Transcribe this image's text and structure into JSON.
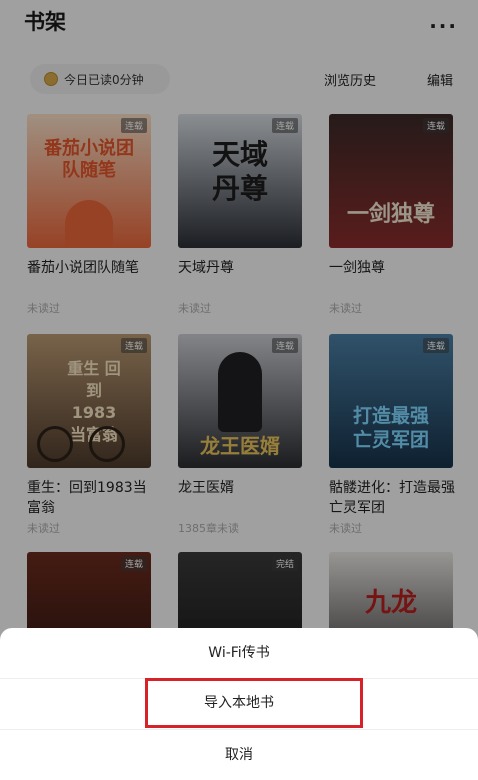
{
  "header": {
    "title": "书架",
    "more_label": "···"
  },
  "toolbar": {
    "reading_time": "今日已读0分钟",
    "history": "浏览历史",
    "edit": "编辑"
  },
  "books": [
    {
      "title": "番茄小说团队随笔",
      "status": "未读过",
      "tag": "连载",
      "cover_text": "番茄小说团队随笔",
      "colors": [
        "#f6ddc6",
        "#e8663a"
      ]
    },
    {
      "title": "天域丹尊",
      "status": "未读过",
      "tag": "连载",
      "cover_text": "天域丹尊",
      "colors": [
        "#d6dbe0",
        "#2a2e36"
      ]
    },
    {
      "title": "一剑独尊",
      "status": "未读过",
      "tag": "连载",
      "cover_text": "一剑独尊",
      "colors": [
        "#3a2a28",
        "#8a2b2b"
      ]
    },
    {
      "title": "重生：回到1983当富翁",
      "status": "未读过",
      "tag": "连载",
      "cover_text": "重生 回到1983当富翁",
      "colors": [
        "#b99872",
        "#4d3a2b"
      ]
    },
    {
      "title": "龙王医婿",
      "status": "1385章未读",
      "tag": "连载",
      "cover_text": "龙王医婿",
      "colors": [
        "#c9ccd2",
        "#2b2c30"
      ]
    },
    {
      "title": "骷髅进化：打造最强亡灵军团",
      "status": "未读过",
      "tag": "连载",
      "cover_text": "打造最强亡灵军团",
      "colors": [
        "#4a7ea3",
        "#17324a"
      ]
    },
    {
      "title": "",
      "status": "",
      "tag": "连载",
      "cover_text": "",
      "colors": [
        "#6a2b1e",
        "#2a1410"
      ]
    },
    {
      "title": "",
      "status": "",
      "tag": "完结",
      "cover_text": "",
      "colors": [
        "#3a3a3a",
        "#141414"
      ]
    },
    {
      "title": "",
      "status": "",
      "tag": "",
      "cover_text": "九龙",
      "colors": [
        "#e9e6e2",
        "#2a2a2a"
      ]
    }
  ],
  "sheet": {
    "wifi": "Wi-Fi传书",
    "import_local": "导入本地书",
    "cancel": "取消"
  }
}
